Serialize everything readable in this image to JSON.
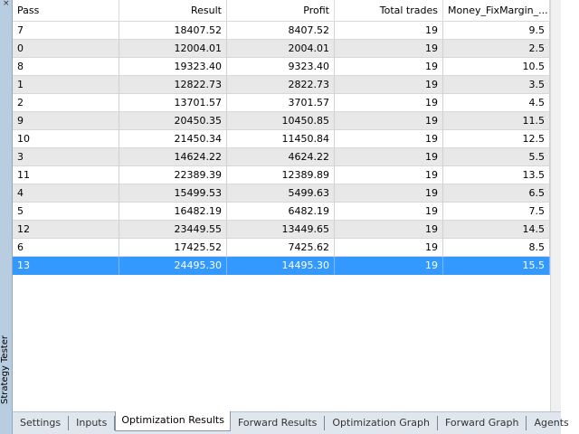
{
  "sidebar": {
    "label": "Strategy Tester",
    "handle": "×"
  },
  "table": {
    "columns": [
      "Pass",
      "Result",
      "Profit",
      "Total trades",
      "Money_FixMargin_..."
    ],
    "rows": [
      [
        "7",
        "18407.52",
        "8407.52",
        "19",
        "9.5"
      ],
      [
        "0",
        "12004.01",
        "2004.01",
        "19",
        "2.5"
      ],
      [
        "8",
        "19323.40",
        "9323.40",
        "19",
        "10.5"
      ],
      [
        "1",
        "12822.73",
        "2822.73",
        "19",
        "3.5"
      ],
      [
        "2",
        "13701.57",
        "3701.57",
        "19",
        "4.5"
      ],
      [
        "9",
        "20450.35",
        "10450.85",
        "19",
        "11.5"
      ],
      [
        "10",
        "21450.34",
        "11450.84",
        "19",
        "12.5"
      ],
      [
        "3",
        "14624.22",
        "4624.22",
        "19",
        "5.5"
      ],
      [
        "11",
        "22389.39",
        "12389.89",
        "19",
        "13.5"
      ],
      [
        "4",
        "15499.53",
        "5499.63",
        "19",
        "6.5"
      ],
      [
        "5",
        "16482.19",
        "6482.19",
        "19",
        "7.5"
      ],
      [
        "12",
        "23449.55",
        "13449.65",
        "19",
        "14.5"
      ],
      [
        "6",
        "17425.52",
        "7425.62",
        "19",
        "8.5"
      ],
      [
        "13",
        "24495.30",
        "14495.30",
        "19",
        "15.5"
      ]
    ],
    "selected_index": 13
  },
  "tabs": [
    {
      "label": "Settings",
      "active": false
    },
    {
      "label": "Inputs",
      "active": false
    },
    {
      "label": "Optimization Results",
      "active": true
    },
    {
      "label": "Forward Results",
      "active": false
    },
    {
      "label": "Optimization Graph",
      "active": false
    },
    {
      "label": "Forward Graph",
      "active": false
    },
    {
      "label": "Agents",
      "active": false
    }
  ],
  "colors": {
    "selection": "#3399ff",
    "alt_row": "#e8e8e8",
    "sidebar": "#b9cde0"
  }
}
